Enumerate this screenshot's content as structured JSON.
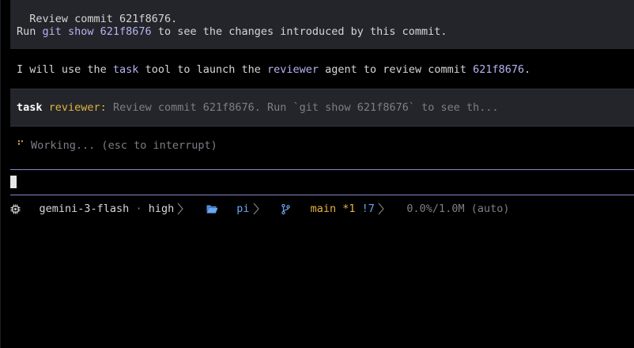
{
  "conversation": {
    "user_message": {
      "line1": "Review commit 621f8676.",
      "line2": {
        "before": "Run ",
        "command": "git show 621f8676",
        "after": " to see the changes introduced by this commit."
      }
    },
    "assistant_message": {
      "p1": "I will use the ",
      "tool": "task",
      "p2": " tool to launch the ",
      "agent": "reviewer",
      "p3": " agent to review commit ",
      "commit": "621f8676",
      "p4": "."
    },
    "tool_call": {
      "tool": "task",
      "agent": "reviewer:",
      "args": "Review commit 621f8676. Run `git show 621f8676` to see th..."
    },
    "working": {
      "spinner": "⠋",
      "text": "Working... (esc to interrupt)"
    }
  },
  "status_bar": {
    "model": "gemini-3-flash",
    "separator": "·",
    "thinking_level": "high",
    "folder": "pi",
    "branch": "main",
    "staged": "*1",
    "modified": "!7",
    "context": "0.0%/1.0M (auto)"
  },
  "icons": {
    "model": "chip-icon",
    "folder": "folder-open-icon",
    "branch": "git-branch-icon",
    "separator": "chevron-right-icon"
  },
  "colors": {
    "accent": "#b6b3f2",
    "warning": "#e2b341",
    "info": "#69a7f0",
    "muted": "#7d7f86",
    "panel": "#23252a",
    "rule": "#8a86c8"
  }
}
